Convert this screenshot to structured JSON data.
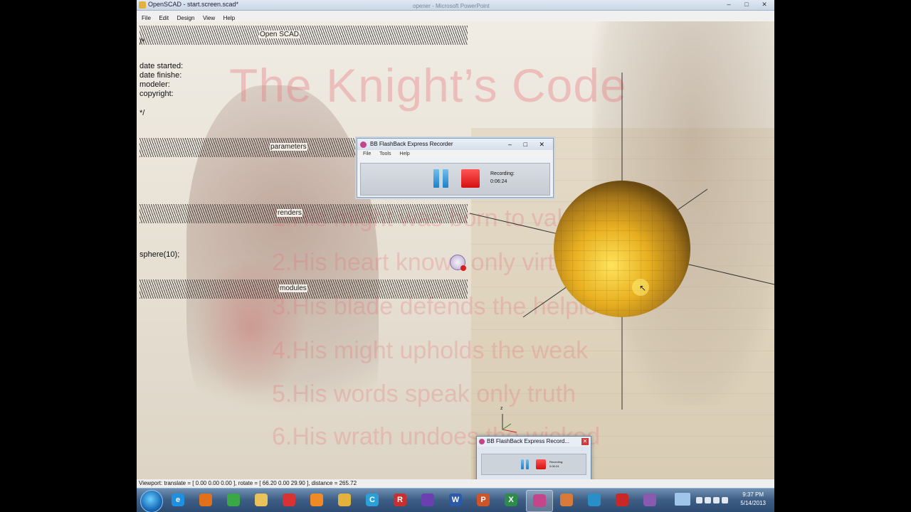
{
  "window": {
    "title": "OpenSCAD - start.screen.scad*",
    "background_title": "opener - Microsoft PowerPoint",
    "controls": {
      "minimize": "–",
      "maximize": "□",
      "close": "✕"
    }
  },
  "menu": [
    "File",
    "Edit",
    "Design",
    "View",
    "Help"
  ],
  "slide": {
    "title": "The Knight’s Code",
    "verses": [
      "1.His might was born to valour",
      "2.His heart knows only virtue",
      "3.His blade defends the helpless",
      "4.His might upholds the weak",
      "5.His words speak only truth",
      "6.His wrath undoes the wicked"
    ]
  },
  "editor": {
    "header_label": "Open SCAD",
    "comment_open": "/*",
    "meta": [
      "date started:",
      "date finishe:",
      "modeler:",
      "copyright:"
    ],
    "comment_close": "*/",
    "section_parameters": "parameters",
    "section_renders": "renders",
    "code": "sphere(10);",
    "section_modules": "modules"
  },
  "recorder": {
    "title": "BB FlashBack Express Recorder",
    "menu": [
      "File",
      "Tools",
      "Help"
    ],
    "status_label": "Recording:",
    "time": "0:06:24"
  },
  "recorder_thumb": {
    "title": "BB FlashBack Express Record...",
    "status_label": "Recording:",
    "time": "0:06:24"
  },
  "viewport": {
    "axis_label": "z",
    "sphere_color": "#e8b020"
  },
  "statusbar": {
    "text": "Viewport: translate = [ 0.00 0.00 0.00 ], rotate = [ 66.20 0.00 29.90 ], distance = 265.72"
  },
  "taskbar": {
    "apps": [
      {
        "name": "ie-icon",
        "glyph": "e",
        "color": "#1f8fe0"
      },
      {
        "name": "firefox-icon",
        "glyph": "",
        "color": "#e0701a"
      },
      {
        "name": "chrome-icon",
        "glyph": "",
        "color": "#3aa845"
      },
      {
        "name": "explorer-folder-icon",
        "glyph": "",
        "color": "#e8c25a"
      },
      {
        "name": "sketchup-icon",
        "glyph": "",
        "color": "#d83232"
      },
      {
        "name": "blender-icon",
        "glyph": "",
        "color": "#f08a24"
      },
      {
        "name": "openscad-icon",
        "glyph": "",
        "color": "#e3b23c"
      },
      {
        "name": "c-app-icon",
        "glyph": "C",
        "color": "#2aa0d8"
      },
      {
        "name": "r-app-icon",
        "glyph": "R",
        "color": "#c83030"
      },
      {
        "name": "visual-studio-icon",
        "glyph": "",
        "color": "#6a3fb0"
      },
      {
        "name": "word-icon",
        "glyph": "W",
        "color": "#2b5aa8"
      },
      {
        "name": "powerpoint-icon",
        "glyph": "P",
        "color": "#d0542a"
      },
      {
        "name": "excel-icon",
        "glyph": "X",
        "color": "#2e8b4b"
      },
      {
        "name": "flashback-icon",
        "glyph": "",
        "color": "#c4458a"
      },
      {
        "name": "paint-icon",
        "glyph": "",
        "color": "#d87b3a"
      },
      {
        "name": "network-app-icon",
        "glyph": "",
        "color": "#2a8fc8"
      },
      {
        "name": "red-app-icon",
        "glyph": "",
        "color": "#c82828"
      },
      {
        "name": "flashback-player-icon",
        "glyph": "",
        "color": "#8a5ab0"
      }
    ],
    "time": "9:37 PM",
    "date": "5/14/2013"
  }
}
